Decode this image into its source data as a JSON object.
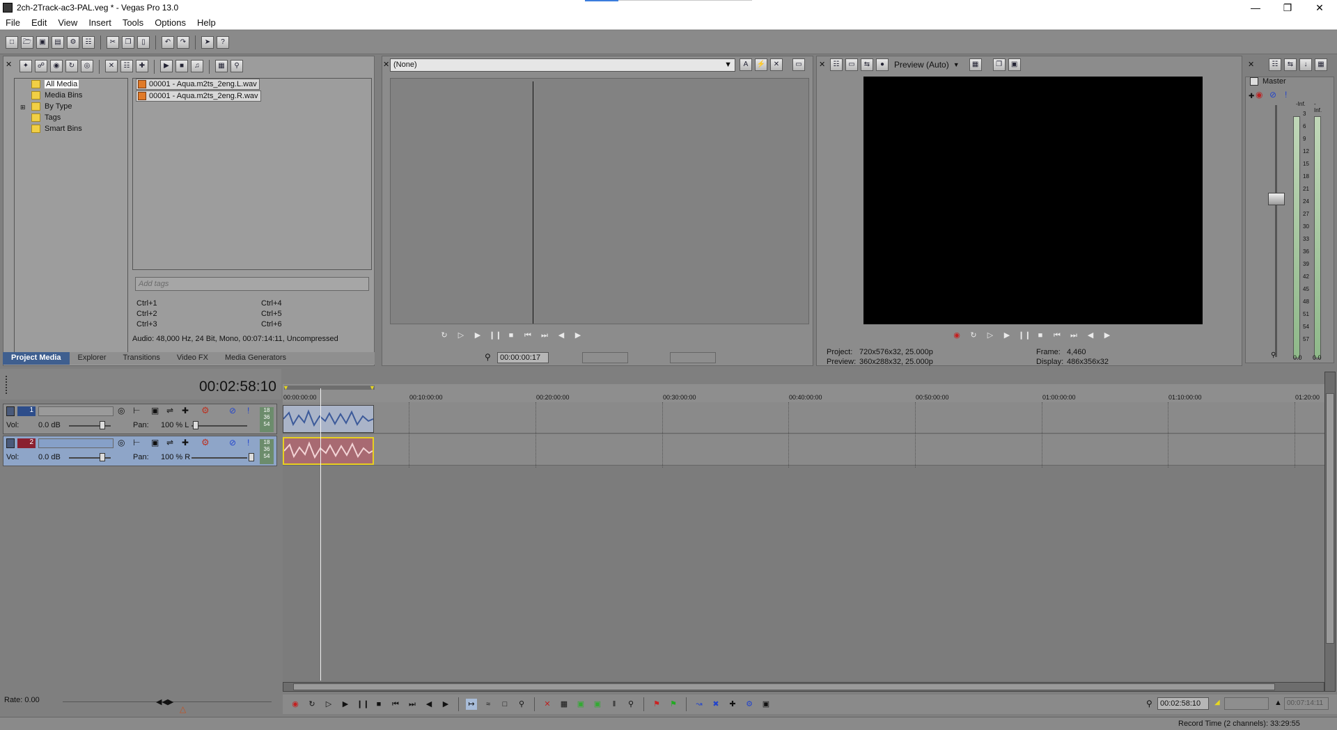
{
  "window": {
    "title": "2ch-2Track-ac3-PAL.veg * - Vegas Pro 13.0"
  },
  "menu": [
    "File",
    "Edit",
    "View",
    "Insert",
    "Tools",
    "Options",
    "Help"
  ],
  "media_tree": [
    "All Media",
    "Media Bins",
    "By Type",
    "Tags",
    "Smart Bins"
  ],
  "media_files": [
    "00001 - Aqua.m2ts_2eng.L.wav",
    "00001 - Aqua.m2ts_2eng.R.wav"
  ],
  "tags_placeholder": "Add tags",
  "shortcuts": [
    "Ctrl+1",
    "Ctrl+2",
    "Ctrl+3",
    "Ctrl+4",
    "Ctrl+5",
    "Ctrl+6"
  ],
  "media_info": "Audio: 48,000 Hz, 24 Bit, Mono, 00:07:14:11, Uncompressed",
  "tabs": [
    "Project Media",
    "Explorer",
    "Transitions",
    "Video FX",
    "Media Generators"
  ],
  "trimmer": {
    "source": "(None)",
    "time": "00:00:00:17"
  },
  "preview": {
    "mode": "Preview (Auto)",
    "project_label": "Project:",
    "project_value": "720x576x32, 25.000p",
    "preview_label": "Preview:",
    "preview_value": "360x288x32, 25.000p",
    "frame_label": "Frame:",
    "frame_value": "4,460",
    "display_label": "Display:",
    "display_value": "486x356x32"
  },
  "master": {
    "title": "Master",
    "scale": [
      "-Inf.",
      "-Inf.",
      "3",
      "6",
      "9",
      "12",
      "15",
      "18",
      "21",
      "24",
      "27",
      "30",
      "33",
      "36",
      "39",
      "42",
      "45",
      "48",
      "51",
      "54",
      "57"
    ],
    "left_readout": "0.0",
    "right_readout": "0.0"
  },
  "timeline": {
    "current_time": "00:02:58:10",
    "ruler": [
      "00:00:00:00",
      "00:10:00:00",
      "00:20:00:00",
      "00:30:00:00",
      "00:40:00:00",
      "00:50:00:00",
      "01:00:00:00",
      "01:10:00:00",
      "01:20:00"
    ],
    "tracks": [
      {
        "number": "1",
        "vol_label": "Vol:",
        "vol": "0.0 dB",
        "pan_label": "Pan:",
        "pan": "100 % L",
        "side": "18 36 54"
      },
      {
        "number": "2",
        "vol_label": "Vol:",
        "vol": "0.0 dB",
        "pan_label": "Pan:",
        "pan": "100 % R",
        "side": "18 36 54"
      }
    ],
    "rate": "Rate: 0.00",
    "cursor_time": "00:02:58:10",
    "end_time": "00:07:14:11",
    "record_time": "Record Time (2 channels): 33:29:55"
  },
  "colors": {
    "selected_tab": "#3f5f8f",
    "track2_clip": "#a86a72",
    "track1_clip": "#aab4c8"
  }
}
